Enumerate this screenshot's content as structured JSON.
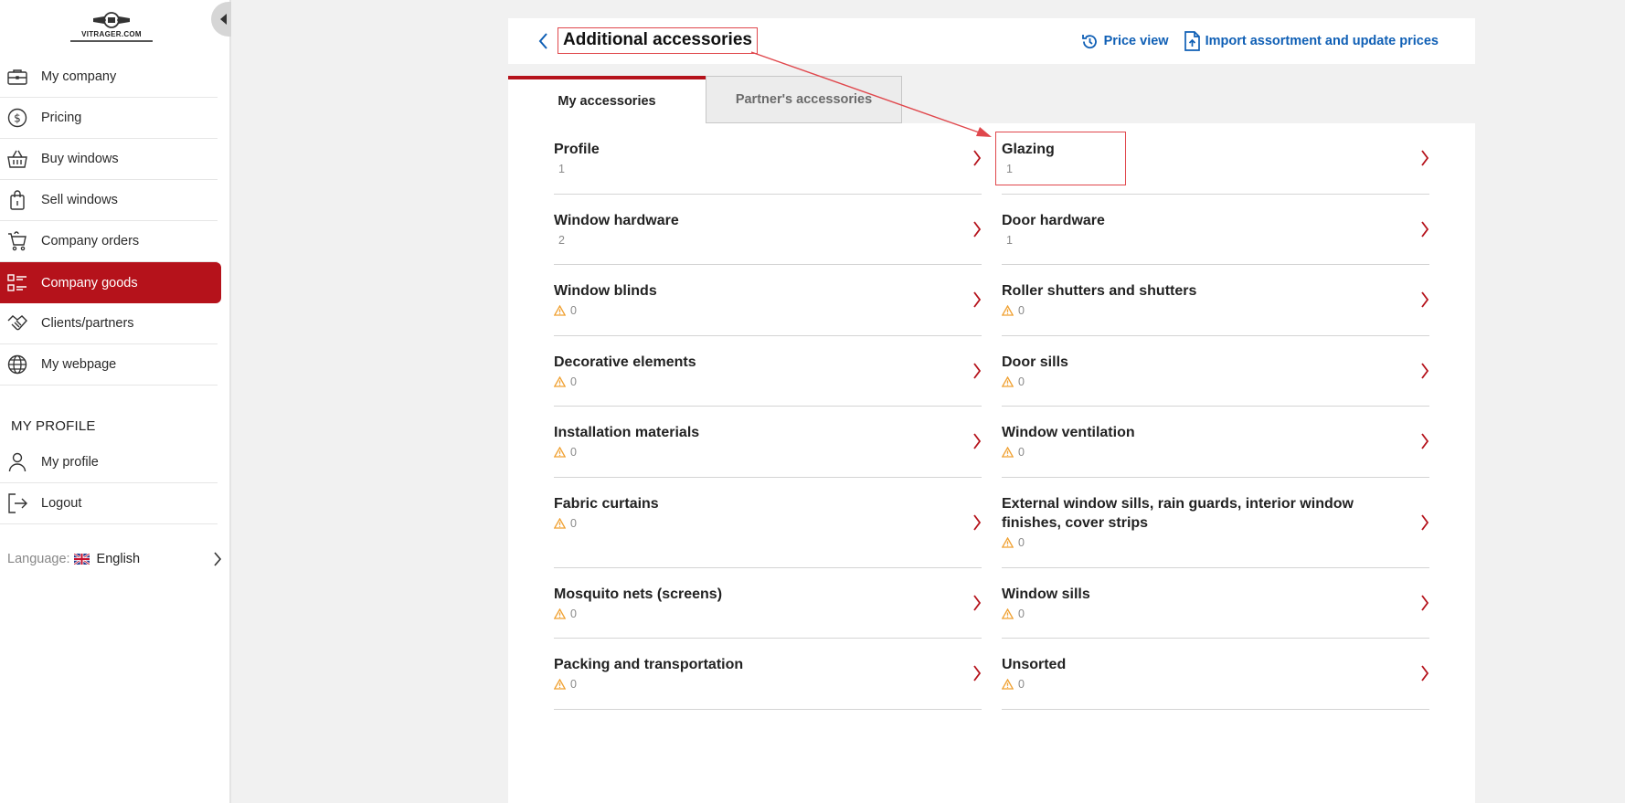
{
  "sidebar": {
    "logo_text": "VITRAGER.COM",
    "items": [
      {
        "label": "My company",
        "icon": "briefcase-icon",
        "active": false
      },
      {
        "label": "Pricing",
        "icon": "dollar-circle-icon",
        "active": false
      },
      {
        "label": "Buy windows",
        "icon": "basket-icon",
        "active": false
      },
      {
        "label": "Sell windows",
        "icon": "shopping-bag-icon",
        "active": false
      },
      {
        "label": "Company orders",
        "icon": "cart-icon",
        "active": false
      },
      {
        "label": "Company goods",
        "icon": "list-grid-icon",
        "active": true
      },
      {
        "label": "Clients/partners",
        "icon": "handshake-icon",
        "active": false
      },
      {
        "label": "My webpage",
        "icon": "globe-icon",
        "active": false
      }
    ],
    "profile_section_title": "MY PROFILE",
    "profile_items": [
      {
        "label": "My profile",
        "icon": "user-icon"
      },
      {
        "label": "Logout",
        "icon": "logout-icon"
      }
    ],
    "language_label": "Language:",
    "language_value": "English",
    "accent_color": "#b5121b"
  },
  "header": {
    "title": "Additional accessories",
    "price_view_label": "Price view",
    "import_label": "Import assortment and update prices",
    "link_color": "#0f5fb5"
  },
  "tabs": [
    {
      "label": "My accessories",
      "active": true
    },
    {
      "label": "Partner's accessories",
      "active": false
    }
  ],
  "categories": {
    "left": [
      {
        "name": "Profile",
        "count": "1",
        "warning": false
      },
      {
        "name": "Window hardware",
        "count": "2",
        "warning": false
      },
      {
        "name": "Window blinds",
        "count": "0",
        "warning": true
      },
      {
        "name": "Decorative elements",
        "count": "0",
        "warning": true
      },
      {
        "name": "Installation materials",
        "count": "0",
        "warning": true
      },
      {
        "name": "Fabric curtains",
        "count": "0",
        "warning": true
      },
      {
        "name": "Mosquito nets (screens)",
        "count": "0",
        "warning": true
      },
      {
        "name": "Packing and transportation",
        "count": "0",
        "warning": true
      }
    ],
    "right": [
      {
        "name": "Glazing",
        "count": "1",
        "warning": false
      },
      {
        "name": "Door hardware",
        "count": "1",
        "warning": false
      },
      {
        "name": "Roller shutters and shutters",
        "count": "0",
        "warning": true
      },
      {
        "name": "Door sills",
        "count": "0",
        "warning": true
      },
      {
        "name": "Window ventilation",
        "count": "0",
        "warning": true
      },
      {
        "name": "External window sills, rain guards, interior window finishes, cover strips",
        "count": "0",
        "warning": true
      },
      {
        "name": "Window sills",
        "count": "0",
        "warning": true
      },
      {
        "name": "Unsorted",
        "count": "0",
        "warning": true
      }
    ]
  }
}
